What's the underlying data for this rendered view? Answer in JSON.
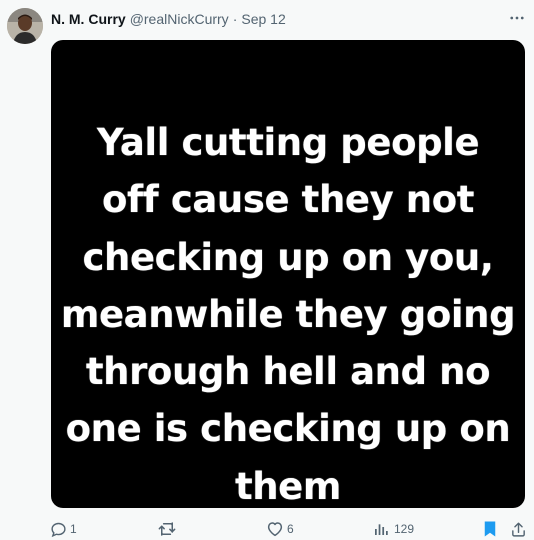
{
  "author": {
    "name": "N. M. Curry",
    "handle": "@realNickCurry",
    "separator": "·",
    "date": "Sep 12"
  },
  "media": {
    "text": "Yall cutting people\noff cause they not\nchecking up on you,\nmeanwhile they going\nthrough hell and no\none is checking up on\nthem"
  },
  "actions": {
    "reply_count": "1",
    "retweet_count": "",
    "like_count": "6",
    "view_count": "129"
  },
  "icons": {
    "more": "more-horizontal-icon",
    "reply": "reply-icon",
    "retweet": "retweet-icon",
    "like": "heart-icon",
    "views": "views-icon",
    "bookmark": "bookmark-icon",
    "share": "share-icon"
  },
  "colors": {
    "secondary_text": "#536471",
    "primary_text": "#0f1419",
    "bookmark_active": "#1d9bf0",
    "media_background": "#000000"
  }
}
